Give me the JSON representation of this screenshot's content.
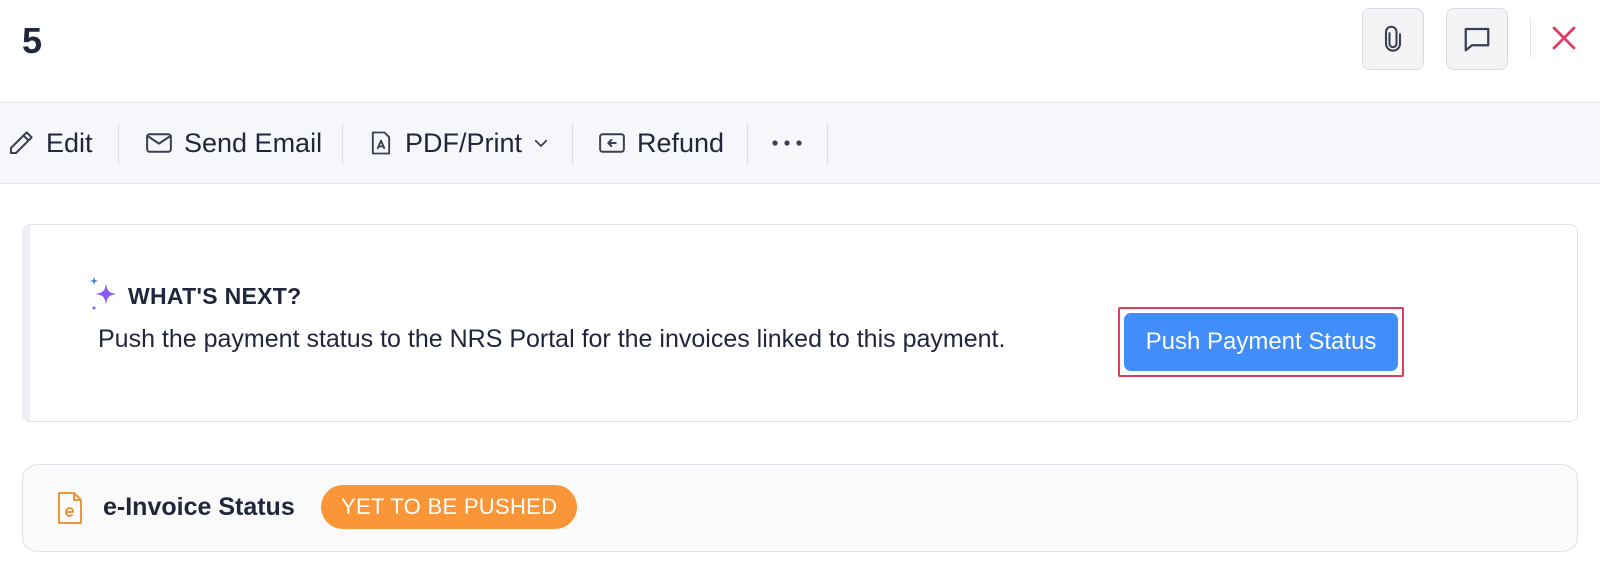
{
  "header": {
    "title": "5",
    "attach_icon": "paperclip-icon",
    "comment_icon": "comment-icon",
    "close_icon": "close-icon",
    "close_color": "#e23b62"
  },
  "toolbar": {
    "edit_label": "Edit",
    "send_email_label": "Send Email",
    "pdf_print_label": "PDF/Print",
    "refund_label": "Refund",
    "more_icon": "more-horizontal-icon"
  },
  "whats_next": {
    "title": "WHAT'S NEXT?",
    "description": "Push the payment status to the NRS Portal for the invoices linked to this payment.",
    "button_label": "Push Payment Status",
    "button_color": "#408dfb",
    "sparkle_icon": "sparkle-icon"
  },
  "einvoice": {
    "label": "e-Invoice Status",
    "status": "YET TO BE PUSHED",
    "status_color": "#fa9638",
    "icon": "e-invoice-document-icon"
  }
}
